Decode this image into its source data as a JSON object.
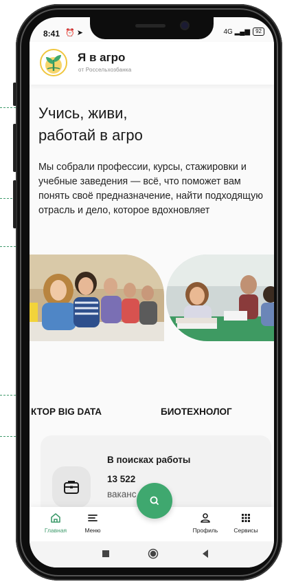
{
  "status_bar": {
    "time": "8:41",
    "left_icons": "⏰ ➤",
    "right_icons": "4G ▂▄▆",
    "battery": "92"
  },
  "header": {
    "title": "Я в агро",
    "subtitle": "от Россельхозбанка"
  },
  "hero": {
    "title_line1": "Учись, живи,",
    "title_line2": "работай в агро",
    "description": "Мы собрали профессии, курсы, стажировки и учебные заведения — всё, что поможет вам понять своё предназначение, найти подходящую отрасль и дело, которое вдохновляет"
  },
  "professions_ticker": {
    "item1": "КТОР BIG DATA",
    "item2": "БИОТЕХНОЛОГ"
  },
  "job_card": {
    "title": "В поисках работы",
    "count": "13 522",
    "unit": "ваканс"
  },
  "bottom_nav": {
    "home": "Главная",
    "menu": "Меню",
    "profile": "Профиль",
    "services": "Сервисы"
  },
  "colors": {
    "accent": "#3fa86f",
    "active_nav": "#3f9b6c",
    "logo_ring": "#f0c63e"
  },
  "icons": {
    "fab": "search-icon",
    "job": "briefcase-icon",
    "home": "home-icon",
    "menu": "menu-icon",
    "profile": "user-icon",
    "services": "grid-icon"
  }
}
